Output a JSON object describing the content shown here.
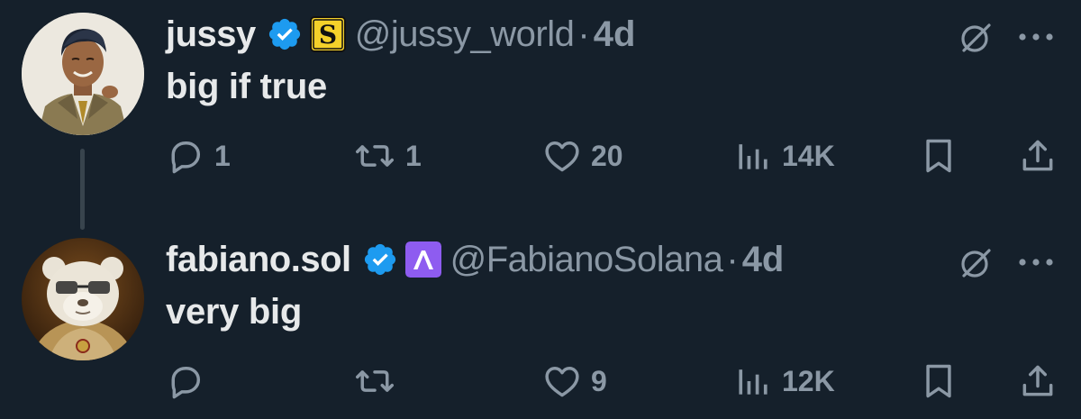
{
  "colors": {
    "background": "#15202b",
    "text_primary": "#e7e9ea",
    "text_secondary": "#8b98a5",
    "verified_blue": "#1d9bf0",
    "thread_line": "#38444d"
  },
  "tweets": [
    {
      "display_name": "jussy",
      "verified_icon": "verified-badge-icon",
      "affiliation_icon": "gothic-s-badge-icon",
      "handle": "@jussy_world",
      "separator": "·",
      "time": "4d",
      "text": "big if true",
      "avatar_icon": "cartoon-man-in-suit-avatar",
      "actions": {
        "replies": "1",
        "retweets": "1",
        "likes": "20",
        "views": "14K"
      }
    },
    {
      "display_name": "fabiano.sol",
      "verified_icon": "verified-badge-icon",
      "affiliation_icon": "purple-a-badge-icon",
      "handle": "@FabianoSolana",
      "separator": "·",
      "time": "4d",
      "text": "very big",
      "avatar_icon": "panda-with-glasses-avatar",
      "actions": {
        "replies": "",
        "retweets": "",
        "likes": "9",
        "views": "12K"
      }
    }
  ]
}
